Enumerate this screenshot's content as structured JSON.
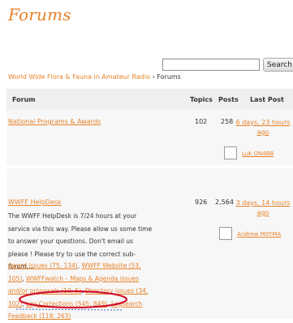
{
  "page": {
    "title": "Forums"
  },
  "search": {
    "placeholder": "",
    "value": "",
    "button_label": "Search"
  },
  "breadcrumb": {
    "root": "World Wide Flora & Fauna in Amateur Radio",
    "separator": "›",
    "current": "Forums"
  },
  "table": {
    "headers": {
      "forum": "Forum",
      "topics": "Topics",
      "posts": "Posts",
      "last_post": "Last Post"
    },
    "rows": [
      {
        "forum": "National Programs & Awards",
        "topics": "102",
        "posts": "258",
        "last_post_line1": "6 days, 23 hours",
        "last_post_line2": "ago",
        "last_user": "Luk ON4BB"
      },
      {
        "forum": "WWFF HelpDesk",
        "topics": "926",
        "posts": "2,564",
        "last_post_line1": "3 days, 14 hours",
        "last_post_line2": "ago",
        "last_user": "Andrew M0YMA",
        "description": [
          "The WWFF HelpDesk is 7/24 hours at your",
          "service via this way. Please allow us some time",
          "to answer your questions. Don't email us",
          "please ! Please try to use the correct sub-",
          "forum...."
        ],
        "subforums": {
          "award_issues": "Award issues (75, 134)",
          "wwff_website": "WWFF Website (53,",
          "wwff_website_cont": "105)",
          "wwffwatch": "WWFFwatch – Maps & Agenda issues",
          "wwffwatch_cont": "and/or proposals (10, 5)",
          "directory_issues": "Directory issues (34,",
          "directory_issues_cont": "102)",
          "log_corrections": "Log Corrections (545, 849)",
          "logsearch": "Logsearch",
          "feedback": "Feedback (119, 263)"
        }
      }
    ]
  },
  "colors": {
    "accent": "#e8832a",
    "header_bg": "#efefef",
    "row_bg": "#f7f7f7",
    "annotation": "#d0102a"
  }
}
